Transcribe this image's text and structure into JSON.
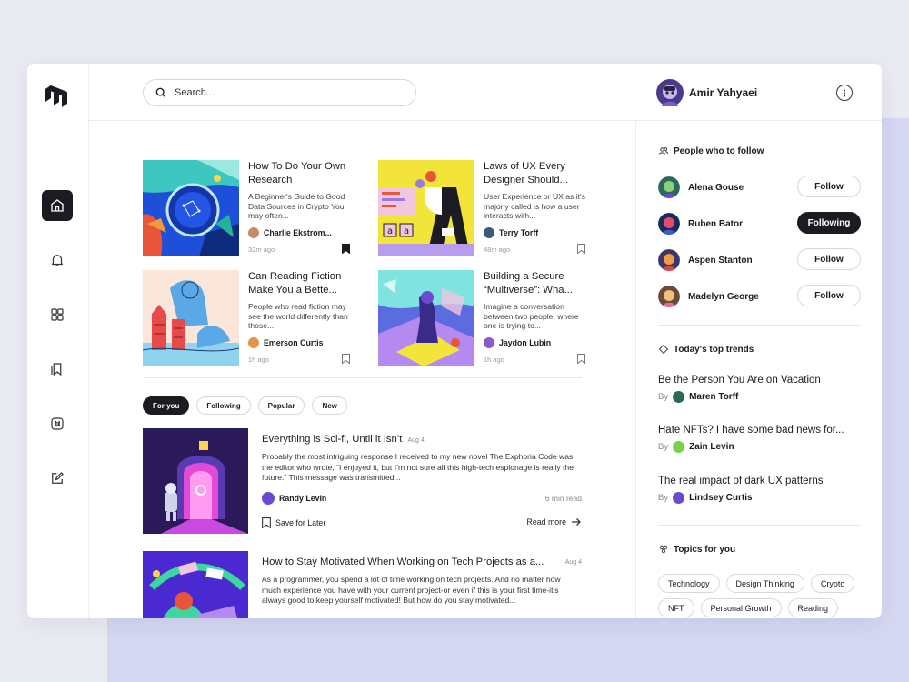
{
  "header": {
    "search_placeholder": "Search...",
    "user_name": "Amir Yahyaei"
  },
  "featured": [
    {
      "title": "How To Do Your Own Research",
      "desc": "A Beginner's Guide to Good Data Sources in Crypto You may often...",
      "author": "Charlie Ekstrom...",
      "time": "32m ago",
      "saved": true
    },
    {
      "title": "Laws of UX Every Designer Should...",
      "desc": "User Experience or UX as it's majorly called is how a user interacts with...",
      "author": "Terry Torff",
      "time": "48m ago",
      "saved": false
    },
    {
      "title": "Can Reading Fiction Make You a Bette...",
      "desc": "People who read fiction may see the world differently than those...",
      "author": "Emerson Curtis",
      "time": "1h ago",
      "saved": false
    },
    {
      "title": "Building a Secure “Multiverse”: Wha...",
      "desc": "Imagine a conversation between two people, where one is trying to...",
      "author": "Jaydon Lubin",
      "time": "1h ago",
      "saved": false
    }
  ],
  "filters": [
    "For you",
    "Following",
    "Popular",
    "New"
  ],
  "articles": [
    {
      "title": "Everything is Sci-fi, Until it Isn’t",
      "date": "Aug 4",
      "desc": "Probably the most intriguing response I received to my new novel The Exphoria Code was the editor who wrote, “I enjoyed it, but I’m not sure all this high-tech espionage is really the future.” This message was transmitted...",
      "author": "Randy Levin",
      "read_time": "6 min read",
      "save_label": "Save for Later",
      "more_label": "Read more"
    },
    {
      "title": "How to Stay Motivated When Working on Tech Projects as a...",
      "date": "Aug 4",
      "desc": "As a programmer, you spend a lot of time working on tech projects. And no matter how much experience you have with your current project-or even if this is your first time-it’s always good to keep yourself motivated! But how do you stay motivated..."
    }
  ],
  "people": {
    "title": "People who to follow",
    "items": [
      {
        "name": "Alena Gouse",
        "button": "Follow",
        "following": false
      },
      {
        "name": "Ruben Bator",
        "button": "Following",
        "following": true
      },
      {
        "name": "Aspen Stanton",
        "button": "Follow",
        "following": false
      },
      {
        "name": "Madelyn George",
        "button": "Follow",
        "following": false
      }
    ]
  },
  "trends": {
    "title": "Today's top trends",
    "by_label": "By",
    "items": [
      {
        "title": "Be the Person You Are on Vacation",
        "author": "Maren Torff"
      },
      {
        "title": "Hate NFTs? I have some bad news for...",
        "author": "Zain Levin"
      },
      {
        "title": "The real impact of dark UX patterns",
        "author": "Lindsey Curtis"
      }
    ]
  },
  "topics": {
    "title": "Topics for you",
    "items": [
      "Technology",
      "Design Thinking",
      "Crypto",
      "NFT",
      "Personal Growth",
      "Reading"
    ]
  }
}
